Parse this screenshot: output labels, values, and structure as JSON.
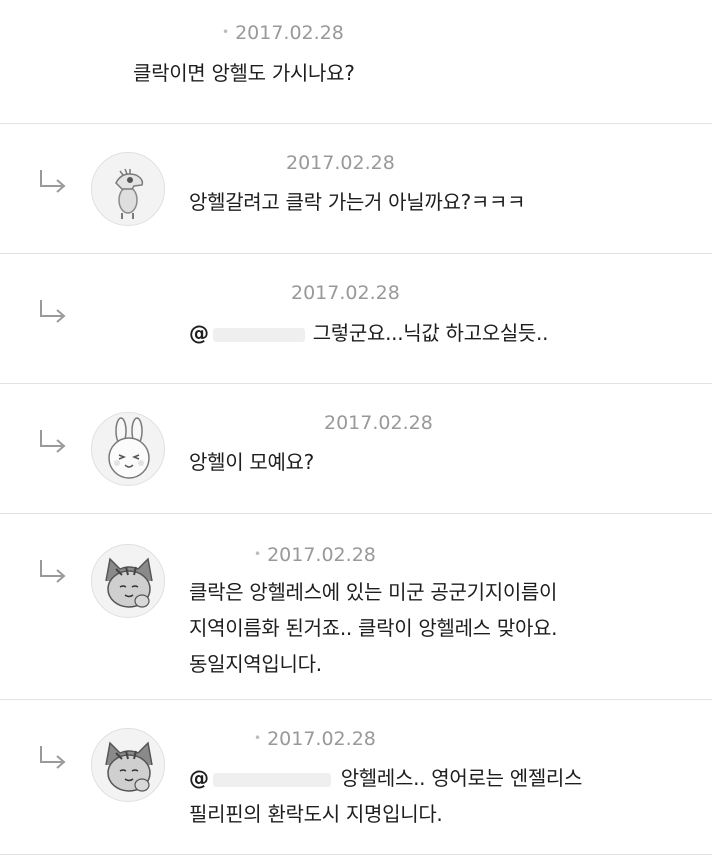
{
  "comments": [
    {
      "date": "2017.02.28",
      "lines": [
        "클락이면 앙헬도 가시나요?"
      ]
    },
    {
      "date": "2017.02.28",
      "lines": [
        "앙헬갈려고 클락 가는거 아닐까요?ㅋㅋㅋ"
      ]
    },
    {
      "date": "2017.02.28",
      "mention": "@",
      "lines": [
        "그렇군요...닉값 하고오실듯.."
      ]
    },
    {
      "date": "2017.02.28",
      "lines": [
        "앙헬이 모예요?"
      ]
    },
    {
      "date": "2017.02.28",
      "lines": [
        "클락은 앙헬레스에 있는 미군 공군기지이름이",
        "지역이름화 된거죠.. 클락이 앙헬레스 맞아요.",
        "동일지역입니다."
      ]
    },
    {
      "date": "2017.02.28",
      "mention": "@",
      "lines": [
        "앙헬레스.. 영어로는 엔젤리스",
        "필리핀의 환락도시 지명입니다."
      ]
    }
  ],
  "icons": {
    "reply_arrow": "reply-arrow-icon",
    "avatar_2": "dinosaur-avatar",
    "avatar_4": "rabbit-avatar",
    "avatar_5": "cat-avatar",
    "avatar_6": "cat-avatar"
  },
  "colors": {
    "text": "#1e1e1e",
    "meta": "#999999",
    "divider": "#e2e2e2"
  }
}
